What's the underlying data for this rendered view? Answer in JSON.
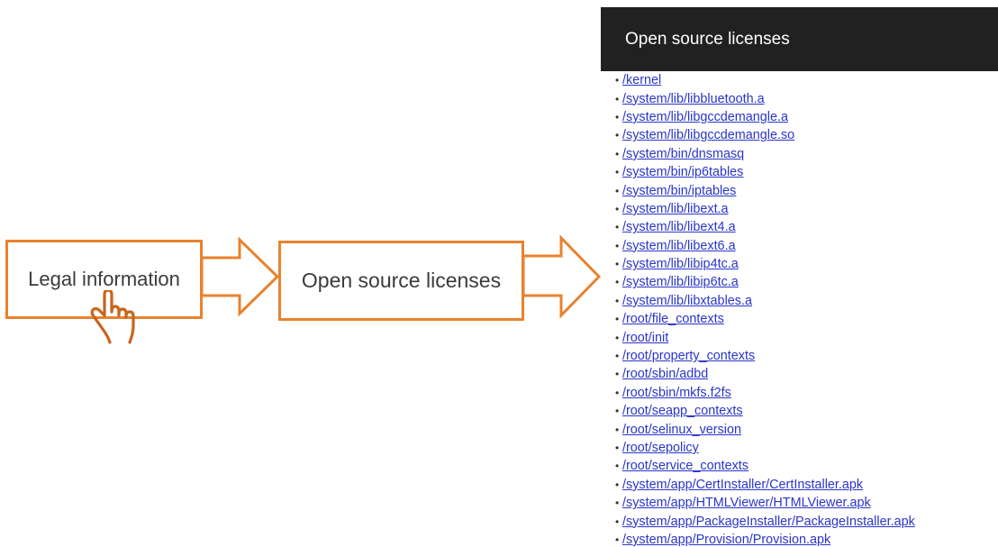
{
  "steps": {
    "step1_label": "Legal information",
    "step2_label": "Open source licenses"
  },
  "colors": {
    "accent_orange": "#e8822e",
    "titlebar_bg": "#212121",
    "link_blue": "#2a35c9"
  },
  "icons": {
    "pointer": "hand-pointer-icon",
    "arrow": "right-arrow-icon"
  },
  "panel": {
    "title": "Open source licenses",
    "bullet": "•",
    "items": [
      "/kernel",
      "/system/lib/libbluetooth.a",
      "/system/lib/libgccdemangle.a",
      "/system/lib/libgccdemangle.so",
      "/system/bin/dnsmasq",
      "/system/bin/ip6tables",
      "/system/bin/iptables",
      "/system/lib/libext.a",
      "/system/lib/libext4.a",
      "/system/lib/libext6.a",
      "/system/lib/libip4tc.a",
      "/system/lib/libip6tc.a",
      "/system/lib/libxtables.a",
      "/root/file_contexts",
      "/root/init",
      "/root/property_contexts",
      "/root/sbin/adbd",
      "/root/sbin/mkfs.f2fs",
      "/root/seapp_contexts",
      "/root/selinux_version",
      "/root/sepolicy",
      "/root/service_contexts",
      "/system/app/CertInstaller/CertInstaller.apk",
      "/system/app/HTMLViewer/HTMLViewer.apk",
      "/system/app/PackageInstaller/PackageInstaller.apk",
      "/system/app/Provision/Provision.apk"
    ]
  }
}
